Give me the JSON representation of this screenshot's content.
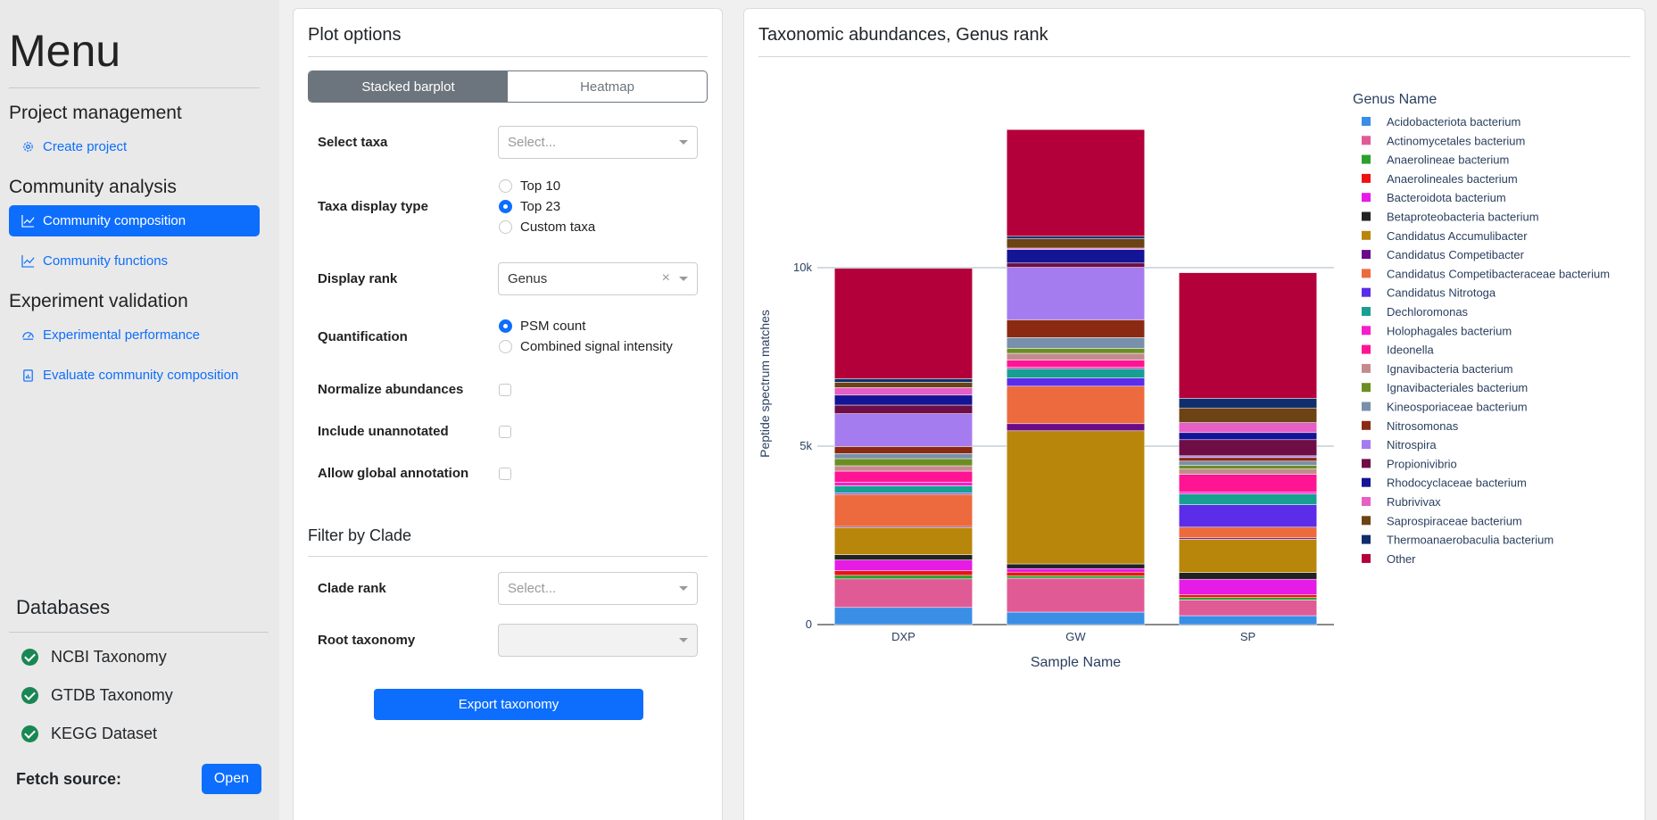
{
  "sidebar": {
    "menu_title": "Menu",
    "sections": {
      "project_management": "Project management",
      "community_analysis": "Community analysis",
      "experiment_validation": "Experiment validation"
    },
    "links": {
      "create_project": "Create project",
      "community_composition": "Community composition",
      "community_functions": "Community functions",
      "experimental_performance": "Experimental performance",
      "evaluate_community_composition": "Evaluate community composition"
    },
    "databases": {
      "title": "Databases",
      "items": [
        "NCBI Taxonomy",
        "GTDB Taxonomy",
        "KEGG Dataset"
      ],
      "fetch_label": "Fetch source:",
      "open_button": "Open"
    }
  },
  "plot_options": {
    "title": "Plot options",
    "tabs": [
      "Stacked barplot",
      "Heatmap"
    ],
    "active_tab": "Stacked barplot",
    "select_taxa": {
      "label": "Select taxa",
      "placeholder": "Select..."
    },
    "taxa_display_type": {
      "label": "Taxa display type",
      "options": [
        "Top 10",
        "Top 23",
        "Custom taxa"
      ],
      "selected": "Top 23"
    },
    "display_rank": {
      "label": "Display rank",
      "value": "Genus"
    },
    "quantification": {
      "label": "Quantification",
      "options": [
        "PSM count",
        "Combined signal intensity"
      ],
      "selected": "PSM count"
    },
    "normalize_abundances": {
      "label": "Normalize abundances",
      "checked": false
    },
    "include_unannotated": {
      "label": "Include unannotated",
      "checked": false
    },
    "allow_global_annotation": {
      "label": "Allow global annotation",
      "checked": false
    },
    "filter_title": "Filter by Clade",
    "clade_rank": {
      "label": "Clade rank",
      "placeholder": "Select..."
    },
    "root_taxonomy": {
      "label": "Root taxonomy",
      "value": ""
    },
    "export_button": "Export taxonomy"
  },
  "chart_card": {
    "title": "Taxonomic abundances, Genus rank"
  },
  "chart_data": {
    "type": "bar",
    "stacked": true,
    "categories": [
      "DXP",
      "GW",
      "SP"
    ],
    "xlabel": "Sample Name",
    "ylabel": "Peptide spectrum matches",
    "ylim": [
      0,
      14500
    ],
    "yticks": [
      0,
      5000,
      10000
    ],
    "ytick_labels": [
      "0",
      "5k",
      "10k"
    ],
    "grid": true,
    "legend_title": "Genus Name",
    "legend_position": "right",
    "series": [
      {
        "name": "Acidobacteriota bacterium",
        "color": "#3a8ee6",
        "values": [
          480,
          350,
          250
        ]
      },
      {
        "name": "Actinomycetales bacterium",
        "color": "#e05a96",
        "values": [
          800,
          950,
          440
        ]
      },
      {
        "name": "Anaerolineae bacterium",
        "color": "#2ca02c",
        "values": [
          100,
          70,
          70
        ]
      },
      {
        "name": "Anaerolineales bacterium",
        "color": "#ee1111",
        "values": [
          130,
          100,
          80
        ]
      },
      {
        "name": "Bacteroidota bacterium",
        "color": "#e61be6",
        "values": [
          300,
          100,
          430
        ]
      },
      {
        "name": "Betaproteobacteria bacterium",
        "color": "#222222",
        "values": [
          150,
          130,
          190
        ]
      },
      {
        "name": "Candidatus Accumulibacter",
        "color": "#b8860b",
        "values": [
          760,
          3730,
          930
        ]
      },
      {
        "name": "Candidatus Competibacter",
        "color": "#6a0c8a",
        "values": [
          30,
          200,
          40
        ]
      },
      {
        "name": "Candidatus Competibacteraceae bacterium",
        "color": "#ec6a3d",
        "values": [
          900,
          1050,
          300
        ]
      },
      {
        "name": "Candidatus Nitrotoga",
        "color": "#5b2de8",
        "values": [
          40,
          230,
          630
        ]
      },
      {
        "name": "Dechloromonas",
        "color": "#17a091",
        "values": [
          200,
          260,
          300
        ]
      },
      {
        "name": "Holophagales bacterium",
        "color": "#f51ec8",
        "values": [
          100,
          40,
          60
        ]
      },
      {
        "name": "Ideonella",
        "color": "#ff1493",
        "values": [
          310,
          200,
          490
        ]
      },
      {
        "name": "Ignavibacteria bacterium",
        "color": "#c48a8f",
        "values": [
          150,
          190,
          150
        ]
      },
      {
        "name": "Ignavibacteriales bacterium",
        "color": "#6b8e23",
        "values": [
          200,
          140,
          100
        ]
      },
      {
        "name": "Kineosporiaceae bacterium",
        "color": "#7890aa",
        "values": [
          140,
          300,
          120
        ]
      },
      {
        "name": "Nitrosomonas",
        "color": "#8b2a12",
        "values": [
          200,
          500,
          100
        ]
      },
      {
        "name": "Nitrospira",
        "color": "#a57cf0",
        "values": [
          920,
          1470,
          50
        ]
      },
      {
        "name": "Propionivibrio",
        "color": "#6e0d46",
        "values": [
          240,
          120,
          450
        ]
      },
      {
        "name": "Rhodocyclaceae bacterium",
        "color": "#141496",
        "values": [
          280,
          380,
          200
        ]
      },
      {
        "name": "Rubrivivax",
        "color": "#e55fc5",
        "values": [
          210,
          40,
          280
        ]
      },
      {
        "name": "Saprospiraceae bacterium",
        "color": "#6b4314",
        "values": [
          150,
          260,
          410
        ]
      },
      {
        "name": "Thermoanaerobaculia bacterium",
        "color": "#0f2e6b",
        "values": [
          100,
          70,
          270
        ]
      },
      {
        "name": "Other",
        "color": "#b3003b",
        "values": [
          3090,
          2990,
          3520
        ]
      }
    ]
  }
}
